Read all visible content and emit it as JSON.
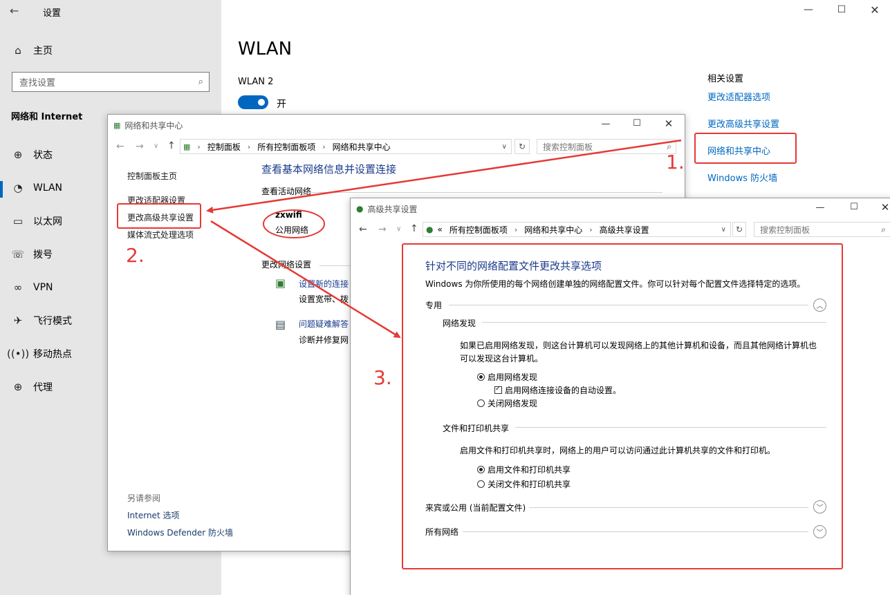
{
  "settings": {
    "title": "设置",
    "home": "主页",
    "search_placeholder": "查找设置",
    "category": "网络和 Internet",
    "nav": [
      {
        "label": "状态",
        "icon": "globe-icon"
      },
      {
        "label": "WLAN",
        "icon": "wifi-icon"
      },
      {
        "label": "以太网",
        "icon": "ethernet-icon"
      },
      {
        "label": "拨号",
        "icon": "dialup-icon"
      },
      {
        "label": "VPN",
        "icon": "vpn-icon"
      },
      {
        "label": "飞行模式",
        "icon": "airplane-icon"
      },
      {
        "label": "移动热点",
        "icon": "hotspot-icon"
      },
      {
        "label": "代理",
        "icon": "globe-icon"
      }
    ],
    "page_title": "WLAN",
    "adapter_name": "WLAN 2",
    "toggle_state": "开",
    "related_title": "相关设置",
    "related_links": [
      "更改适配器选项",
      "更改高级共享设置",
      "网络和共享中心",
      "Windows 防火墙"
    ],
    "accent": "#0067c0"
  },
  "ncsc": {
    "title": "网络和共享中心",
    "breadcrumb": [
      "控制面板",
      "所有控制面板项",
      "网络和共享中心"
    ],
    "search_placeholder": "搜索控制面板",
    "left_links": [
      "控制面板主页",
      "更改适配器设置",
      "更改高级共享设置",
      "媒体流式处理选项"
    ],
    "see_also": "另请参阅",
    "see_also_links": [
      "Internet 选项",
      "Windows Defender 防火墙"
    ],
    "heading": "查看基本网络信息并设置连接",
    "active_networks": "查看活动网络",
    "network_name": "zxwifi",
    "network_type": "公用网络",
    "change_settings": "更改网络设置",
    "task1_title": "设置新的连接",
    "task1_desc": "设置宽带、拨",
    "task2_title": "问题疑难解答",
    "task2_desc": "诊断并修复网"
  },
  "adv": {
    "title": "高级共享设置",
    "breadcrumb_prefix": "«",
    "breadcrumb": [
      "所有控制面板项",
      "网络和共享中心",
      "高级共享设置"
    ],
    "search_placeholder": "搜索控制面板",
    "heading": "针对不同的网络配置文件更改共享选项",
    "desc": "Windows 为你所使用的每个网络创建单独的网络配置文件。你可以针对每个配置文件选择特定的选项。",
    "private_label": "专用",
    "discovery_title": "网络发现",
    "discovery_desc1": "如果已启用网络发现，则这台计算机可以发现网络上的其他计算机和设备，而且其他网络计算机也",
    "discovery_desc2": "可以发现这台计算机。",
    "discovery_on": "启用网络发现",
    "discovery_auto": "启用网络连接设备的自动设置。",
    "discovery_off": "关闭网络发现",
    "fileshare_title": "文件和打印机共享",
    "fileshare_desc": "启用文件和打印机共享时，网络上的用户可以访问通过此计算机共享的文件和打印机。",
    "fileshare_on": "启用文件和打印机共享",
    "fileshare_off": "关闭文件和打印机共享",
    "guest_label": "来宾或公用 (当前配置文件)",
    "all_label": "所有网络"
  },
  "annotations": {
    "step1": "1.",
    "step2": "2.",
    "step3": "3.",
    "color": "#e53935"
  }
}
